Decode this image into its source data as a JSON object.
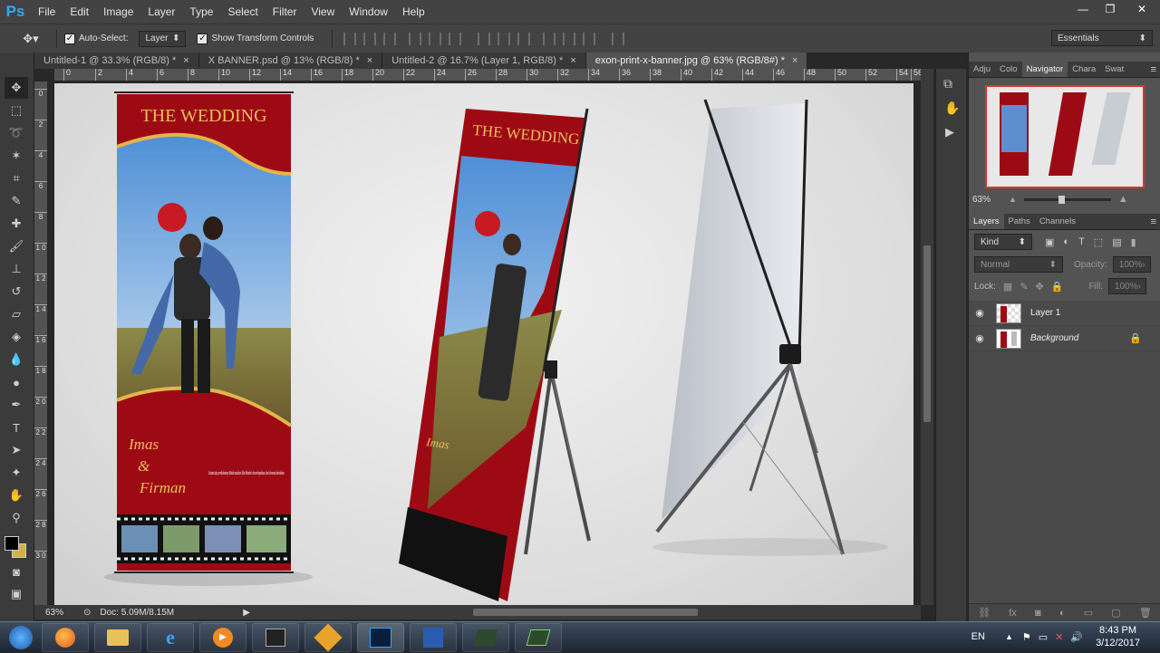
{
  "app": {
    "logo": "Ps"
  },
  "menu": [
    "File",
    "Edit",
    "Image",
    "Layer",
    "Type",
    "Select",
    "Filter",
    "View",
    "Window",
    "Help"
  ],
  "window_controls": [
    "—",
    "❐",
    "✕"
  ],
  "options": {
    "auto_select_label": "Auto-Select:",
    "auto_select_value": "Layer",
    "transform_label": "Show Transform Controls",
    "workspace": "Essentials"
  },
  "tabs": [
    {
      "label": "Untitled-1 @ 33.3% (RGB/8) *",
      "active": false
    },
    {
      "label": "X BANNER.psd @ 13% (RGB/8) *",
      "active": false
    },
    {
      "label": "Untitled-2 @ 16.7% (Layer 1, RGB/8) *",
      "active": false
    },
    {
      "label": "exon-print-x-banner.jpg @ 63% (RGB/8#) *",
      "active": true
    }
  ],
  "ruler_top": [
    "0",
    "2",
    "4",
    "6",
    "8",
    "10",
    "12",
    "14",
    "16",
    "18",
    "20",
    "22",
    "24",
    "26",
    "28",
    "30",
    "32",
    "34",
    "36",
    "38",
    "40",
    "42",
    "44",
    "46",
    "48",
    "50",
    "52",
    "54",
    "56"
  ],
  "ruler_left": [
    "0",
    "2",
    "4",
    "6",
    "8",
    "1 0",
    "1 2",
    "1 4",
    "1 6",
    "1 8",
    "2 0",
    "2 2",
    "2 4",
    "2 6",
    "2 8",
    "3 0"
  ],
  "banner": {
    "title": "THE WEDDING",
    "names_line1": "Imas",
    "names_amp": "&",
    "names_line2": "Firman",
    "message": "Selamat atas pernikahannya Mudah mudahan Allah Memberi dan melimpahkan Atas kebaruan keberkahan."
  },
  "status": {
    "zoom": "63%",
    "doc": "Doc: 5.09M/8.15M"
  },
  "panels": {
    "top_tabs": [
      "Adju",
      "Colo",
      "Navigator",
      "Chara",
      "Swat"
    ],
    "navigator_zoom": "63%",
    "layer_tabs": [
      "Layers",
      "Paths",
      "Channels"
    ],
    "kind_label": "Kind",
    "blend_mode": "Normal",
    "opacity_label": "Opacity:",
    "opacity_value": "100%",
    "lock_label": "Lock:",
    "fill_label": "Fill:",
    "fill_value": "100%",
    "layers": [
      {
        "name": "Layer 1",
        "italic": false
      },
      {
        "name": "Background",
        "italic": true
      }
    ]
  },
  "taskbar": {
    "tray_lang": "EN",
    "time": "8:43 PM",
    "date": "3/12/2017"
  }
}
